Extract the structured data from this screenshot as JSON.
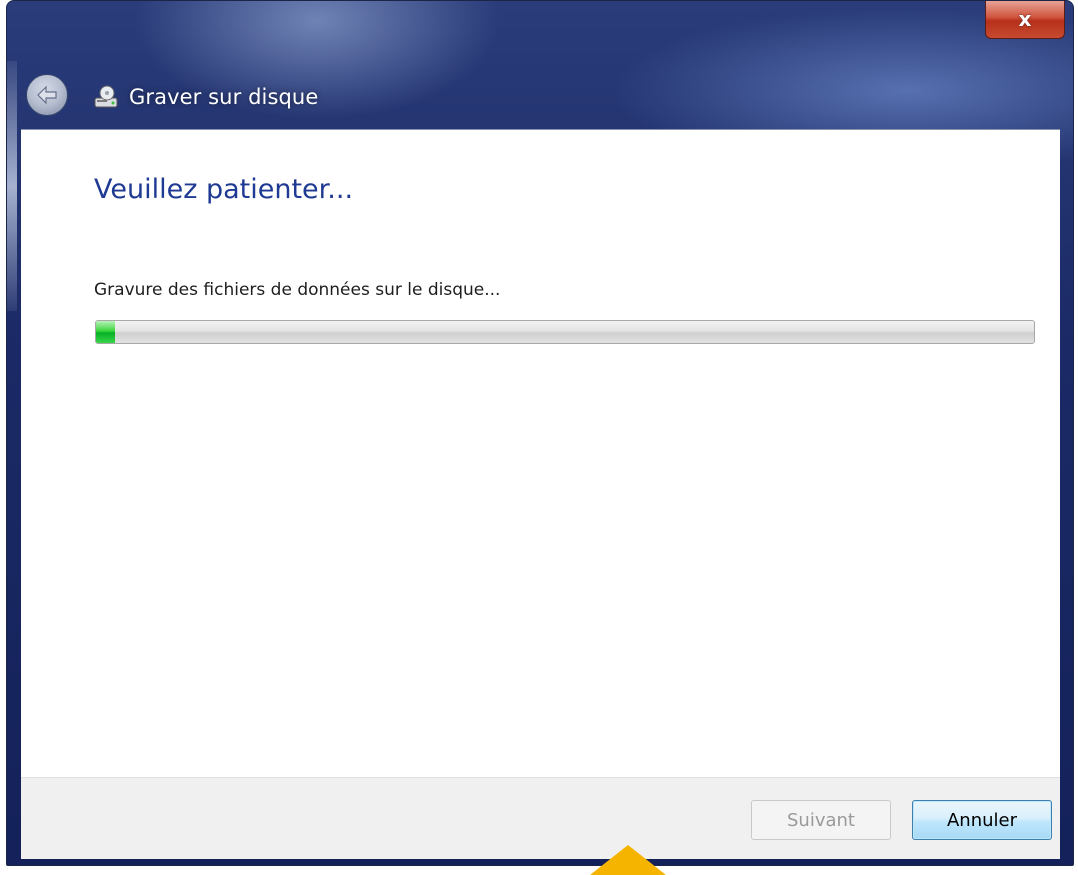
{
  "window": {
    "title": "Graver sur disque",
    "close_label": "x"
  },
  "main": {
    "heading": "Veuillez patienter...",
    "status": "Gravure des fichiers de données sur le disque...",
    "progress_fraction": 0.02
  },
  "footer": {
    "next_label": "Suivant",
    "cancel_label": "Annuler"
  },
  "colors": {
    "heading": "#1f3a93",
    "progress_fill": "#06b025",
    "overlay_arrow": "#f5b400"
  },
  "icons": {
    "back": "back-arrow-icon",
    "app": "disc-burner-icon",
    "close": "close-icon"
  }
}
